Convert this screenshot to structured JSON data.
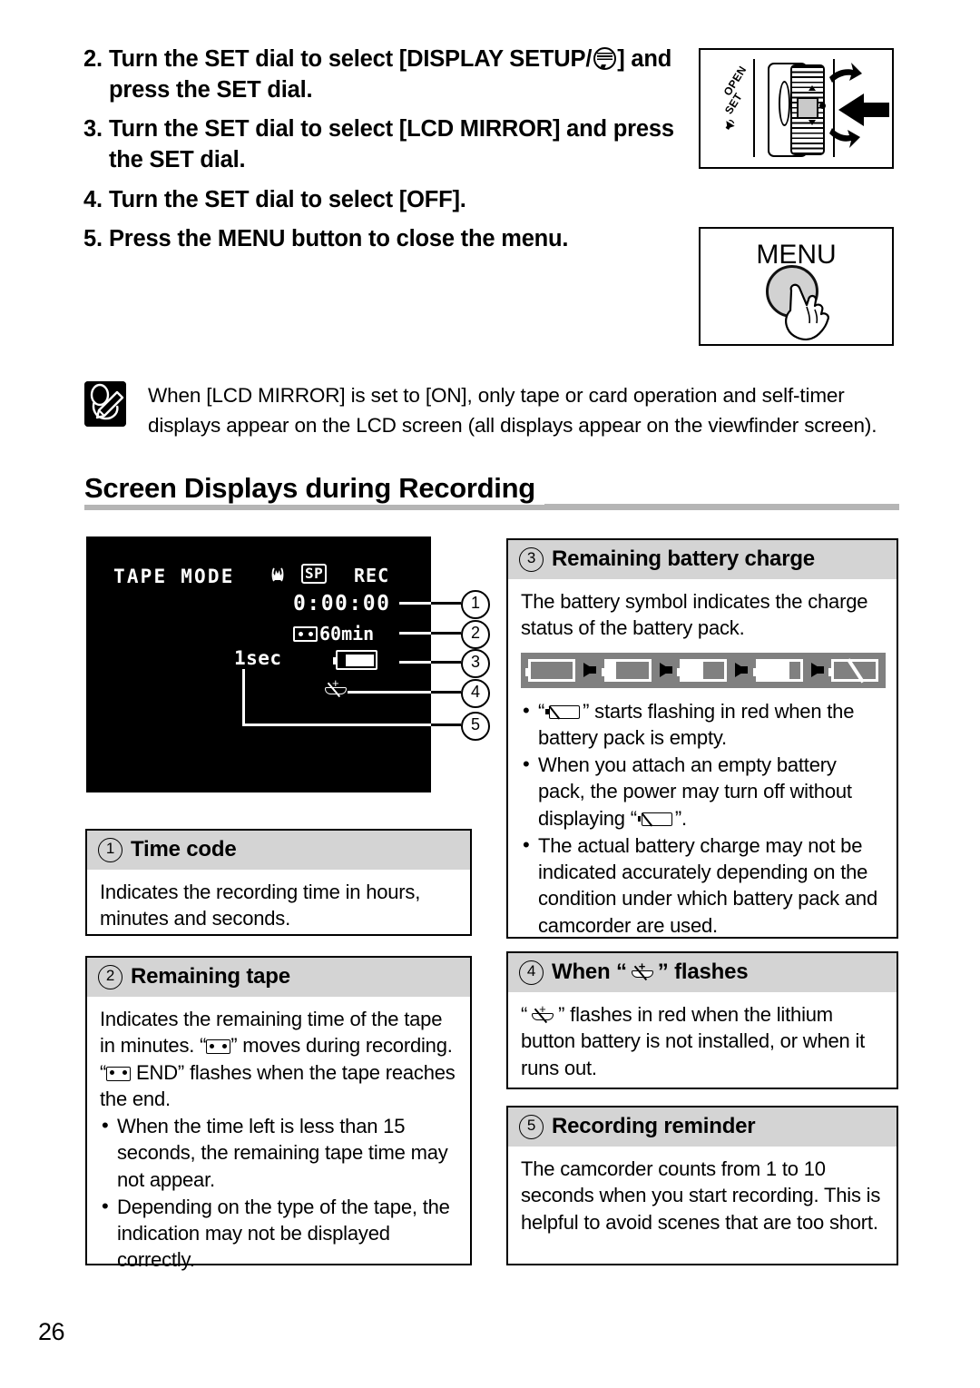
{
  "page": {
    "number": "26"
  },
  "steps": [
    {
      "num": "2.",
      "text_before": "Turn the SET dial to select [DISPLAY SETUP/",
      "icon": "display-setup-icon",
      "text_after": "] and press the SET dial."
    },
    {
      "num": "3.",
      "text_before": "Turn the SET dial to select [LCD MIRROR] and press the SET dial.",
      "icon": "",
      "text_after": ""
    },
    {
      "num": "4.",
      "text_before": "Turn the SET dial to select [OFF].",
      "icon": "",
      "text_after": ""
    },
    {
      "num": "5.",
      "text_before": "Press the MENU button to close the menu.",
      "icon": "",
      "text_after": ""
    }
  ],
  "illustrations": {
    "dial": {
      "label_open": "OPEN",
      "label_set": "SET",
      "label_speaker": "speaker-icon"
    },
    "menu": {
      "label": "MENU"
    }
  },
  "note": {
    "icon": "note-pencil-icon",
    "text": "When [LCD MIRROR] is set to [ON], only tape or card operation and self-timer displays appear on the LCD screen (all displays appear on the viewfinder screen)."
  },
  "section": {
    "title": "Screen Displays during Recording"
  },
  "lcd": {
    "mode": "TAPE MODE",
    "stabilizer_icon": "image-stabilizer-icon",
    "quality": "SP",
    "rec": "REC",
    "timecode": "0:00:00",
    "tape_icon": "tape-cassette-icon",
    "tape_remaining": "60min",
    "battery_icon": "battery-icon",
    "recording_reminder": "1sec",
    "lithium_icon": "lithium-battery-icon",
    "callouts": [
      "1",
      "2",
      "3",
      "4",
      "5"
    ]
  },
  "boxes": {
    "time_code": {
      "num": "1",
      "title": "Time code",
      "body": "Indicates the recording time in hours, minutes and seconds."
    },
    "remaining_tape": {
      "num": "2",
      "title": "Remaining tape",
      "body_1": "Indicates the remaining time of the tape in minutes. “",
      "body_2": "” moves during recording. “",
      "body_3": " END” flashes when the tape reaches the end.",
      "bullets": [
        "When the time left is less than 15 seconds, the remaining tape time may not appear.",
        "Depending on the type of the tape, the indication may not be displayed correctly."
      ]
    },
    "battery_charge": {
      "num": "3",
      "title": "Remaining battery charge",
      "body": "The battery symbol indicates the charge status of the battery pack.",
      "strip": {
        "states": [
          "full",
          "three-quarter",
          "half",
          "quarter",
          "empty"
        ],
        "fill_percents": [
          100,
          78,
          50,
          25,
          0
        ],
        "arrow_icon": "right-arrow-icon"
      },
      "bullet_1_a": "“",
      "bullet_1_b": "” starts flashing in red when the battery pack is empty.",
      "bullet_2_a": "When you attach an empty battery pack, the power may turn off without displaying “",
      "bullet_2_b": "”.",
      "bullet_3": "The actual battery charge may not be indicated accurately depending on the condition under which battery pack and camcorder are used."
    },
    "lithium_flash": {
      "num": "4",
      "title_a": "When “",
      "title_b": "” flashes",
      "body_a": "“",
      "body_b": "” flashes in red when the lithium button battery is not installed, or when it runs out."
    },
    "recording_reminder": {
      "num": "5",
      "title": "Recording reminder",
      "body": "The camcorder counts from 1 to 10 seconds when you start recording. This is helpful to avoid scenes that are too short."
    }
  }
}
